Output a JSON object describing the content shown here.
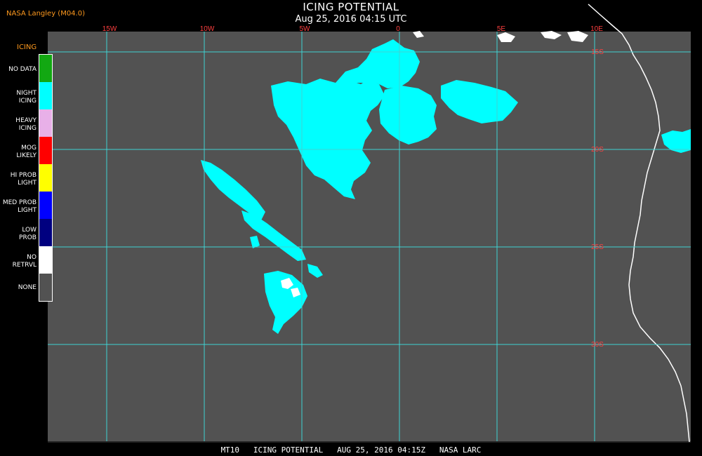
{
  "header": {
    "credit": "NASA Langley (M04.0)",
    "title": "ICING POTENTIAL",
    "subtitle": "Aug 25, 2016 04:15 UTC"
  },
  "legend": {
    "title": "ICING",
    "items": [
      {
        "label": "NO DATA",
        "color": "#12a812"
      },
      {
        "label": "NIGHT\nICING",
        "color": "#00ffff"
      },
      {
        "label": "HEAVY\nICING",
        "color": "#e8b0e8"
      },
      {
        "label": "MOG\nLIKELY",
        "color": "#ff0000"
      },
      {
        "label": "HI PROB\nLIGHT",
        "color": "#ffff00"
      },
      {
        "label": "MED PROB\nLIGHT",
        "color": "#0000ff"
      },
      {
        "label": "LOW\nPROB",
        "color": "#000080"
      },
      {
        "label": "NO\nRETRVL",
        "color": "#ffffff"
      },
      {
        "label": "NONE",
        "color": "#525252"
      }
    ]
  },
  "grid": {
    "lon_labels": [
      "15W",
      "10W",
      "5W",
      "0",
      "5E",
      "10E"
    ],
    "lat_labels": [
      "15S",
      "20S",
      "25S",
      "30S"
    ],
    "grid_color": "#3fd3d3",
    "label_color": "#ff4040"
  },
  "footer": "MT10   ICING POTENTIAL   AUG 25, 2016 04:15Z   NASA LARC"
}
